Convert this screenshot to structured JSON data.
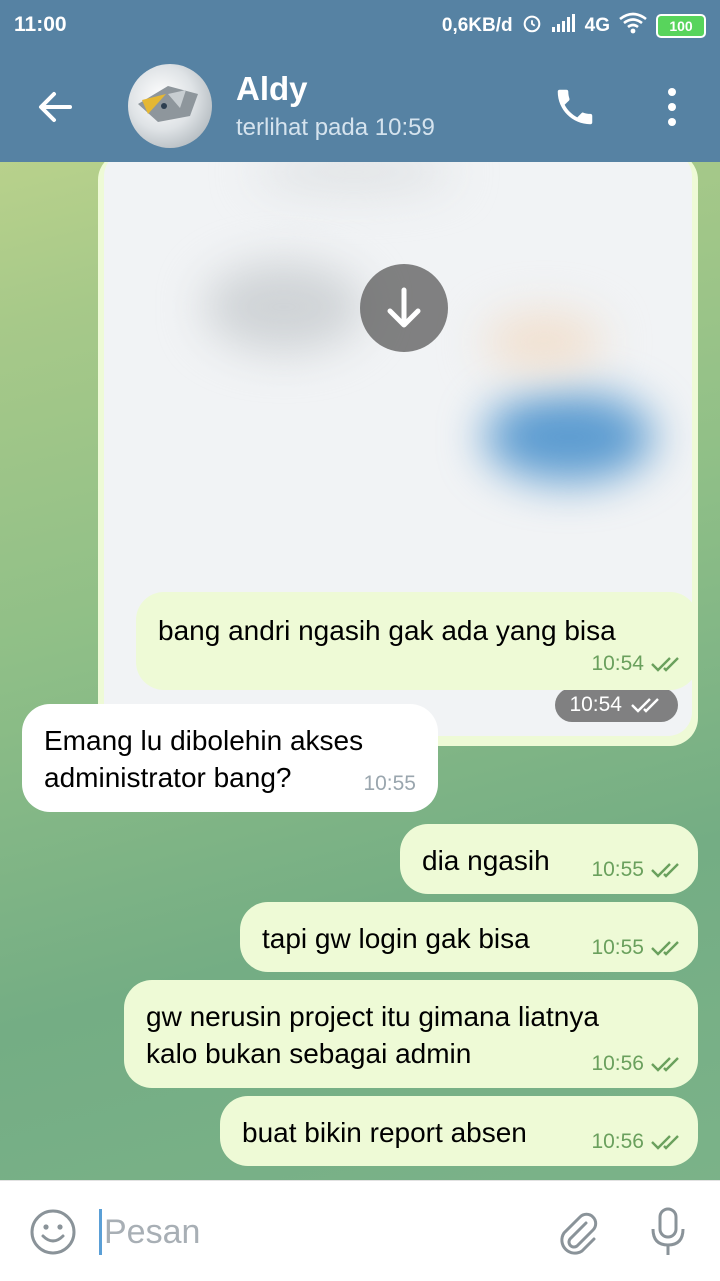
{
  "status_bar": {
    "time": "11:00",
    "network_speed": "0,6KB/d",
    "network_type": "4G",
    "battery": "100",
    "icons": [
      "alarm-icon",
      "signal-icon",
      "wifi-icon",
      "battery-icon"
    ]
  },
  "header": {
    "contact_name": "Aldy",
    "last_seen": "terlihat pada  10:59",
    "icons": [
      "back-arrow-icon",
      "phone-icon",
      "more-vertical-icon"
    ]
  },
  "messages": [
    {
      "type": "image",
      "direction": "out",
      "time": "10:54",
      "status": "read"
    },
    {
      "type": "text",
      "direction": "out",
      "text": "bang andri ngasih gak ada yang bisa",
      "time": "10:54",
      "status": "read"
    },
    {
      "type": "text",
      "direction": "in",
      "text": "Emang lu dibolehin akses\nadministrator bang?",
      "time": "10:55"
    },
    {
      "type": "text",
      "direction": "out",
      "text": "dia ngasih",
      "time": "10:55",
      "status": "read"
    },
    {
      "type": "text",
      "direction": "out",
      "text": "tapi gw login gak bisa",
      "time": "10:55",
      "status": "read"
    },
    {
      "type": "text",
      "direction": "out",
      "text": "gw nerusin project itu gimana liatnya\nkalo bukan sebagai admin",
      "time": "10:56",
      "status": "read"
    },
    {
      "type": "text",
      "direction": "out",
      "text": "buat bikin report absen",
      "time": "10:56",
      "status": "read"
    }
  ],
  "composer": {
    "placeholder": "Pesan",
    "value": "",
    "icons": [
      "emoji-icon",
      "attach-icon",
      "mic-icon"
    ]
  },
  "colors": {
    "header": "#5682a3",
    "outgoing_bubble": "#eefad6",
    "incoming_bubble": "#ffffff",
    "read_check": "#6aa05d",
    "caret": "#5a9fd6"
  }
}
